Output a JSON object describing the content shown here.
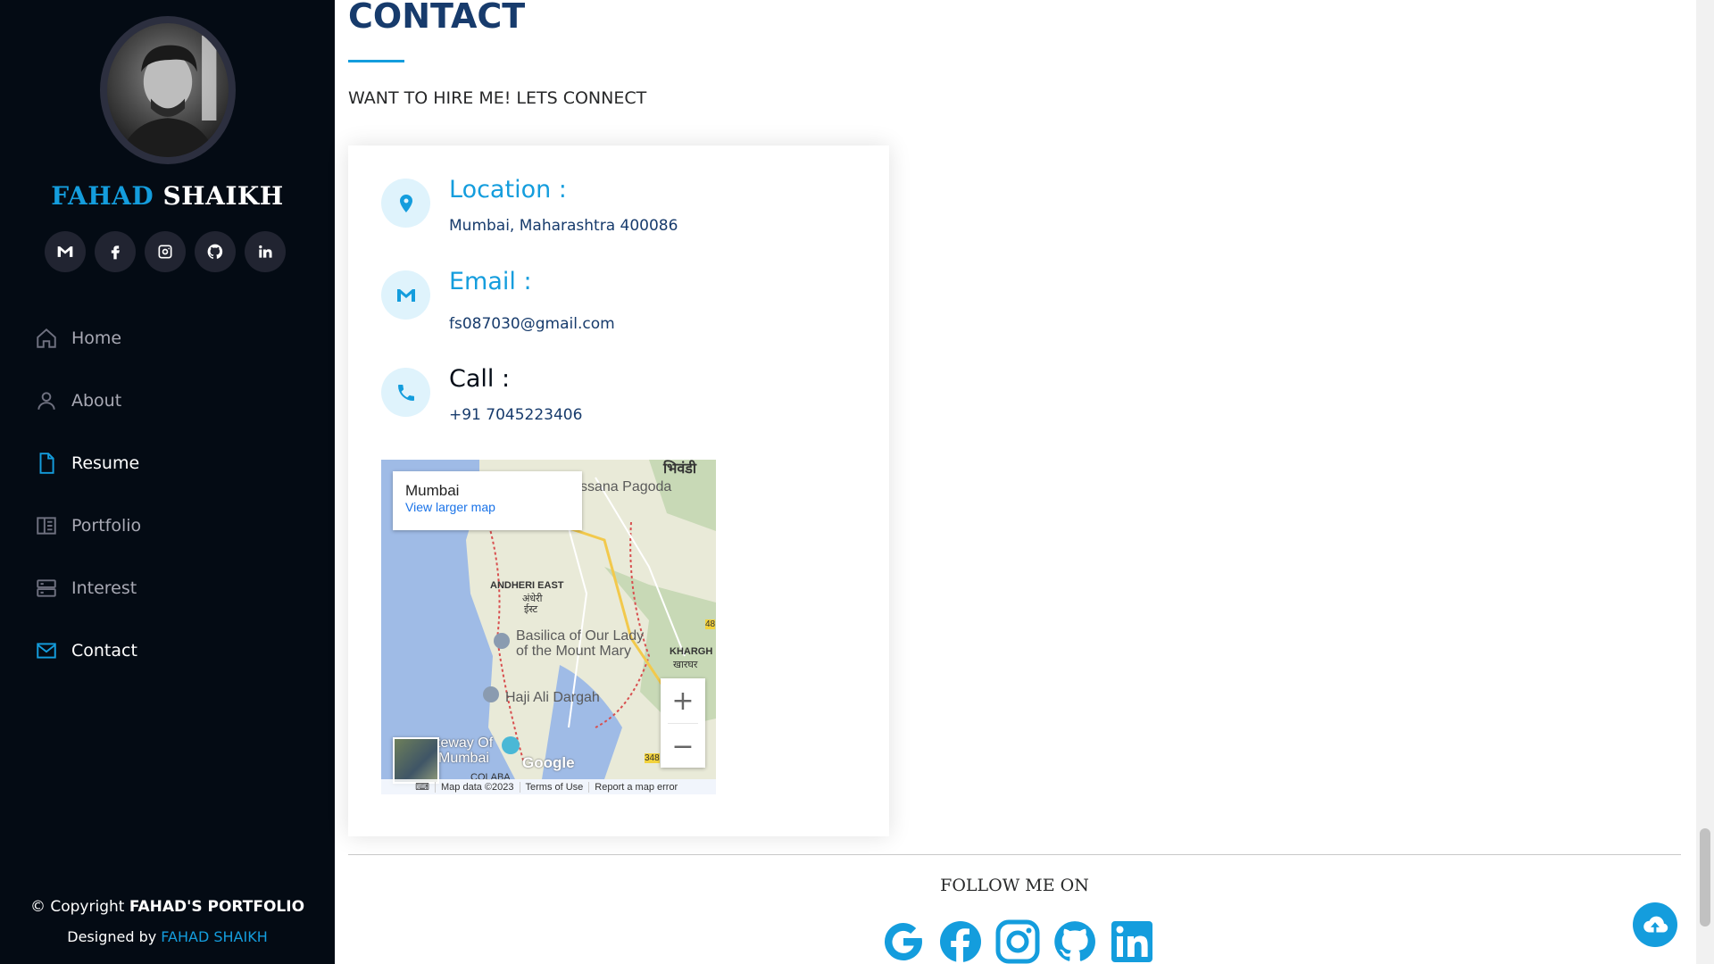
{
  "sidebar": {
    "name_first": "FAHAD",
    "name_last": "SHAIKH",
    "socials": [
      {
        "icon": "gmail-icon"
      },
      {
        "icon": "facebook-icon"
      },
      {
        "icon": "instagram-icon"
      },
      {
        "icon": "github-icon"
      },
      {
        "icon": "linkedin-icon"
      }
    ],
    "nav": [
      {
        "label": "Home",
        "icon": "home-icon",
        "active": false
      },
      {
        "label": "About",
        "icon": "person-icon",
        "active": false
      },
      {
        "label": "Resume",
        "icon": "file-icon",
        "active": true
      },
      {
        "label": "Portfolio",
        "icon": "book-icon",
        "active": false
      },
      {
        "label": "Interest",
        "icon": "server-icon",
        "active": false
      },
      {
        "label": "Contact",
        "icon": "envelope-icon",
        "active": true
      }
    ],
    "copyright_prefix": "© Copyright",
    "copyright_name": "FAHAD'S PORTFOLIO",
    "designed_prefix": "Designed by",
    "designed_name": "FAHAD SHAIKH"
  },
  "contact": {
    "title": "CONTACT",
    "subtitle": "WANT TO HIRE ME! LETS CONNECT",
    "location_label": "Location :",
    "location_value": "Mumbai, Maharashtra 400086",
    "email_label": "Email :",
    "email_value": "fs087030@gmail.com",
    "call_label": "Call :",
    "call_value": "+91 7045223406"
  },
  "map": {
    "place": "Mumbai",
    "view_larger": "View larger map",
    "labels": {
      "bhiwandi": "भिवंडी",
      "pagoda": "ssana Pagoda",
      "andheri": "ANDHERI EAST",
      "andheri_mr": "अंधेरी",
      "andheri_mr2": "ईस्ट",
      "basilica1": "Basilica of Our Lady",
      "basilica2": "of the Mount Mary",
      "khargh": "KHARGH",
      "khargh_mr": "खारघर",
      "haji": "Haji Ali Dargah",
      "gateway1": "teway Of",
      "gateway2": "Mumbai",
      "colaba": "COLABA",
      "road48": "48",
      "road348": "348"
    },
    "google": "Google",
    "zoom_in": "+",
    "zoom_out": "−",
    "map_data": "Map data ©2023",
    "terms": "Terms of Use",
    "report": "Report a map error"
  },
  "footer": {
    "follow": "FOLLOW ME ON",
    "icons": [
      "google-icon",
      "facebook-icon",
      "instagram-icon",
      "github-icon",
      "linkedin-icon"
    ]
  },
  "colors": {
    "accent": "#149ddd",
    "sidebar_bg": "#040b14",
    "title": "#173b6c"
  }
}
